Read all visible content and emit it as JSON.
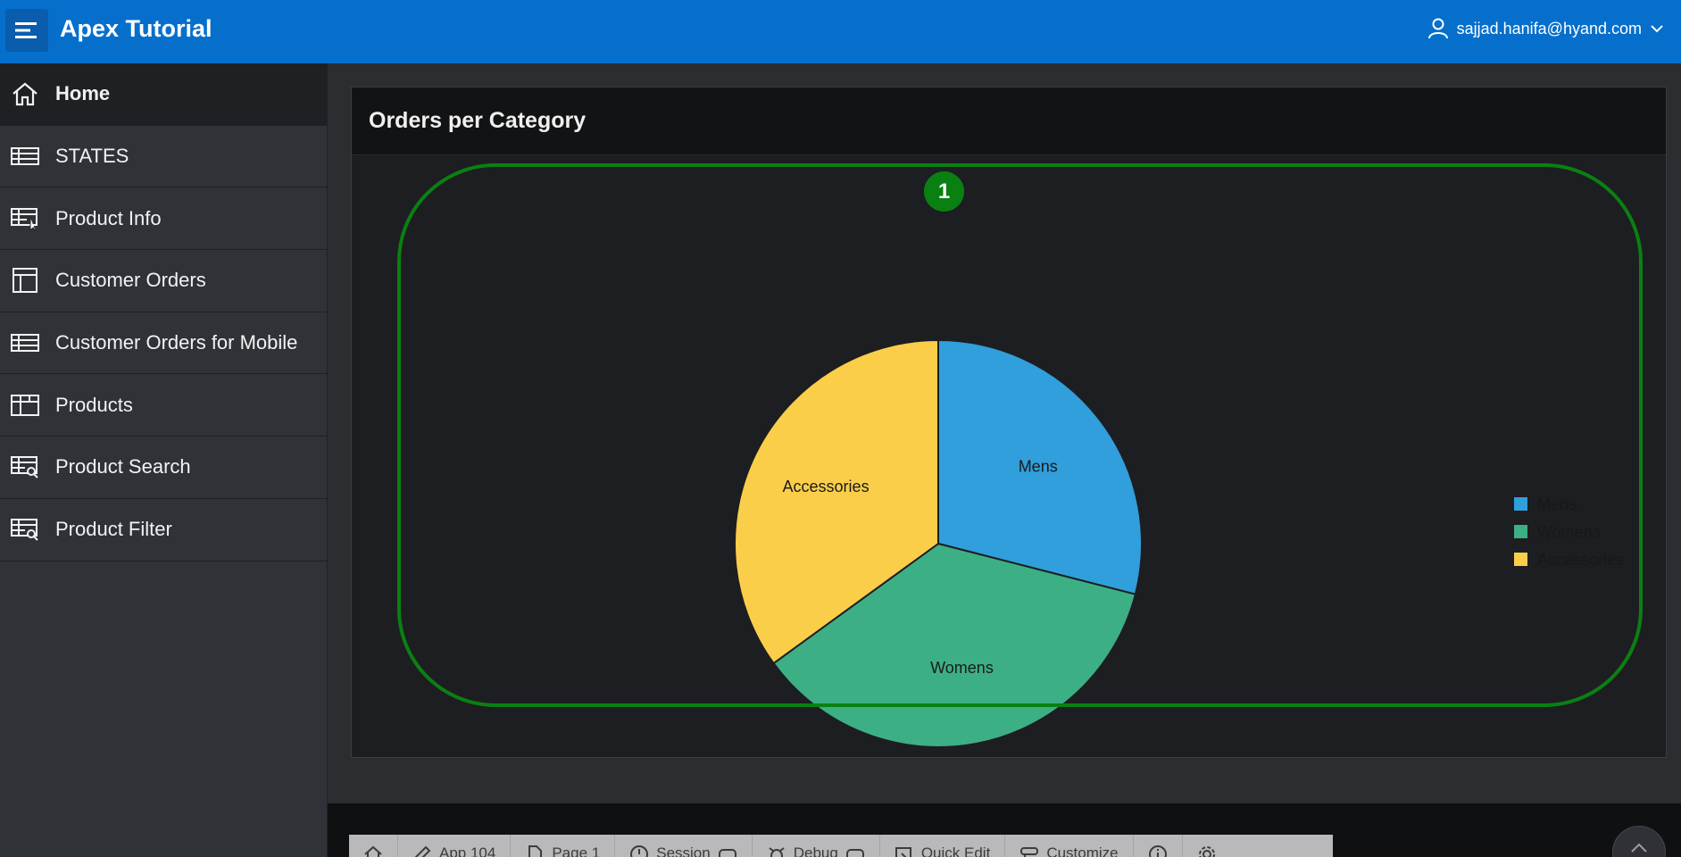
{
  "header": {
    "app_title": "Apex Tutorial",
    "user": "sajjad.hanifa@hyand.com"
  },
  "sidebar": {
    "items": [
      {
        "label": "Home",
        "icon": "home-icon",
        "active": true
      },
      {
        "label": "STATES",
        "icon": "table-icon"
      },
      {
        "label": "Product Info",
        "icon": "table-edit-icon"
      },
      {
        "label": "Customer Orders",
        "icon": "layout-icon"
      },
      {
        "label": "Customer Orders for Mobile",
        "icon": "table-icon"
      },
      {
        "label": "Products",
        "icon": "grid-icon"
      },
      {
        "label": "Product Search",
        "icon": "table-search-icon"
      },
      {
        "label": "Product Filter",
        "icon": "table-search-icon"
      }
    ]
  },
  "region": {
    "title": "Orders per Category",
    "highlight_number": "1"
  },
  "chart_data": {
    "type": "pie",
    "categories": [
      "Mens",
      "Womens",
      "Accessories"
    ],
    "values": [
      29,
      36,
      35
    ],
    "colors": [
      "#309fdb",
      "#3daf84",
      "#fbce4a"
    ],
    "legend": "right"
  },
  "dev_toolbar": {
    "items": [
      {
        "label": "",
        "icon": "home-icon"
      },
      {
        "label": "App 104",
        "icon": "edit-icon"
      },
      {
        "label": "Page 1",
        "icon": "page-icon"
      },
      {
        "label": "Session",
        "icon": "clock-icon"
      },
      {
        "label": "Debug",
        "icon": "bug-icon"
      },
      {
        "label": "Quick Edit",
        "icon": "quick-edit-icon"
      },
      {
        "label": "Customize",
        "icon": "customize-icon"
      },
      {
        "label": "",
        "icon": "info-icon"
      },
      {
        "label": "",
        "icon": "gear-icon"
      }
    ]
  }
}
